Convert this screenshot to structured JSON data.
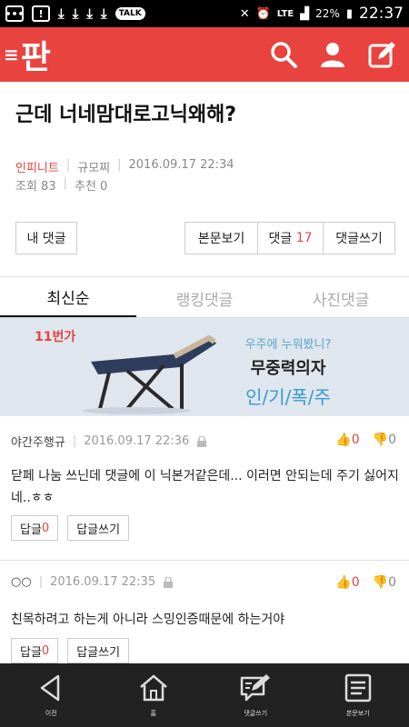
{
  "status_bar": {
    "battery": "22%",
    "time": "22:37",
    "network": "LTE",
    "talk_badge": "TALK"
  },
  "app": {
    "logo": "판",
    "accent": "#e8433f"
  },
  "post": {
    "title": "근데 너네맘대로고닉왜해?",
    "author": "인피니트",
    "board": "규모찌",
    "date": "2016.09.17 22:34",
    "views_label": "조회 83",
    "likes_label": "추천 0"
  },
  "buttons": {
    "my_comments": "내 댓글",
    "view_post": "본문보기",
    "comments_label": "댓글",
    "comments_count": "17",
    "write_comment": "댓글쓰기"
  },
  "tabs": [
    {
      "label": "최신순",
      "active": true
    },
    {
      "label": "랭킹댓글",
      "active": false
    },
    {
      "label": "사진댓글",
      "active": false
    }
  ],
  "ad": {
    "brand": "11번가",
    "line1": "우주에 누워봤니?",
    "line2": "무중력의자",
    "line3": "인/기/폭/주"
  },
  "comments": [
    {
      "author": "야간주행규",
      "date": "2016.09.17 22:36",
      "up": "0",
      "down": "0",
      "text": "닫페 나눔 쓰닌데 댓글에 이 닉본거같은데... 이러면 안되는데 주기 싫어지네..ㅎㅎ",
      "reply_label": "답글",
      "reply_count": "0",
      "write_reply": "답글쓰기"
    },
    {
      "author": "○○",
      "date": "2016.09.17 22:35",
      "up": "0",
      "down": "0",
      "text": "친목하려고 하는게 아니라 스밍인증때문에 하는거야",
      "reply_label": "답글",
      "reply_count": "0",
      "write_reply": "답글쓰기"
    }
  ],
  "bottom_nav": [
    {
      "label": "이전",
      "icon": "back-icon"
    },
    {
      "label": "홈",
      "icon": "home-icon"
    },
    {
      "label": "댓글쓰기",
      "icon": "write-comment-icon"
    },
    {
      "label": "본문보기",
      "icon": "document-icon"
    }
  ]
}
